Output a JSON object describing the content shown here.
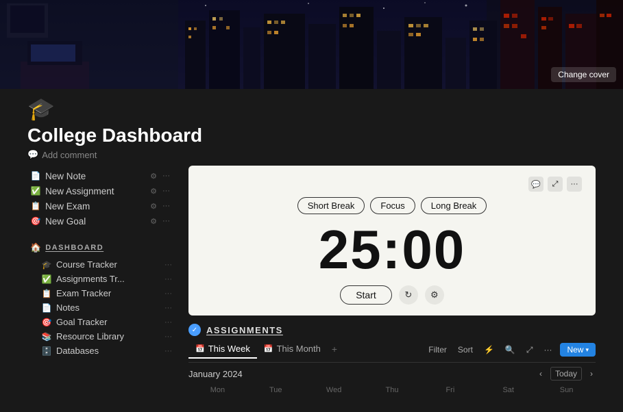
{
  "cover": {
    "change_cover_label": "Change cover"
  },
  "page": {
    "icon": "🎓",
    "title": "College Dashboard",
    "add_comment_label": "Add comment"
  },
  "quick_actions": [
    {
      "id": "new-note",
      "icon": "📄",
      "label": "New Note"
    },
    {
      "id": "new-assignment",
      "icon": "✅",
      "label": "New Assignment"
    },
    {
      "id": "new-exam",
      "icon": "📋",
      "label": "New Exam"
    },
    {
      "id": "new-goal",
      "icon": "🎯",
      "label": "New Goal"
    }
  ],
  "dashboard_nav": {
    "header_label": "DASHBOARD",
    "items": [
      {
        "id": "course-tracker",
        "icon": "🎓",
        "label": "Course Tracker"
      },
      {
        "id": "assignments-tracker",
        "icon": "✅",
        "label": "Assignments Tr..."
      },
      {
        "id": "exam-tracker",
        "icon": "📋",
        "label": "Exam Tracker"
      },
      {
        "id": "notes",
        "icon": "📄",
        "label": "Notes"
      },
      {
        "id": "goal-tracker",
        "icon": "🎯",
        "label": "Goal Tracker"
      },
      {
        "id": "resource-library",
        "icon": "📚",
        "label": "Resource Library"
      },
      {
        "id": "databases",
        "icon": "🗄️",
        "label": "Databases"
      }
    ]
  },
  "timer": {
    "tabs": [
      "Short Break",
      "Focus",
      "Long Break"
    ],
    "display": "25:00",
    "start_label": "Start",
    "header_icons": [
      "💬",
      "⤢",
      "···"
    ]
  },
  "assignments": {
    "title": "ASSIGNMENTS",
    "tabs": [
      {
        "id": "this-week",
        "icon": "📅",
        "label": "This Week",
        "active": true
      },
      {
        "id": "this-month",
        "icon": "📅",
        "label": "This Month",
        "active": false
      }
    ],
    "add_tab_label": "+",
    "toolbar": {
      "filter_label": "Filter",
      "sort_label": "Sort",
      "bolt_icon": "⚡",
      "search_icon": "🔍",
      "expand_icon": "⤢",
      "more_icon": "···"
    },
    "new_button_label": "New",
    "calendar": {
      "month_label": "January 2024",
      "today_label": "Today",
      "days": [
        "Mon",
        "Tue",
        "Wed",
        "Thu",
        "Fri",
        "Sat",
        "Sun"
      ]
    }
  }
}
